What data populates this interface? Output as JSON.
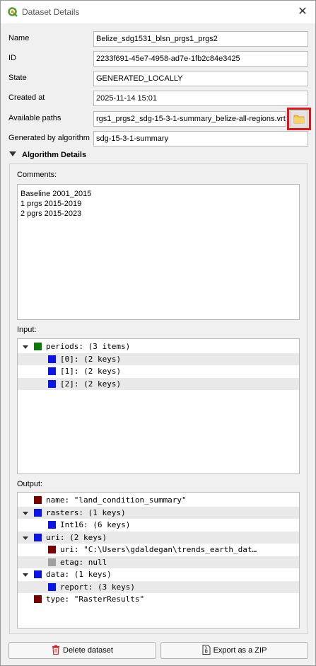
{
  "window": {
    "title": "Dataset Details",
    "close_glyph": "✕"
  },
  "fields": {
    "name": {
      "label": "Name",
      "value": "Belize_sdg1531_blsn_prgs1_prgs2"
    },
    "id": {
      "label": "ID",
      "value": "2233f691-45e7-4958-ad7e-1fb2c84e3425"
    },
    "state": {
      "label": "State",
      "value": "GENERATED_LOCALLY"
    },
    "created": {
      "label": "Created at",
      "value": "2025-11-14 15:01"
    },
    "paths": {
      "label": "Available paths",
      "value": "rgs1_prgs2_sdg-15-3-1-summary_belize-all-regions.vrt"
    },
    "algorithm": {
      "label": "Generated by algorithm",
      "value": "sdg-15-3-1-summary"
    }
  },
  "algorithm_details": {
    "heading": "Algorithm Details",
    "comments_label": "Comments:",
    "comments": [
      "Baseline 2001_2015",
      "1 prgs 2015-2019",
      "2 pgrs 2015-2023"
    ],
    "input_label": "Input:",
    "input_tree": [
      {
        "text": "periods: (3 items)",
        "color": "green",
        "expander": "down",
        "level": 0
      },
      {
        "text": "[0]: (2 keys)",
        "color": "blue",
        "expander": "right",
        "level": 1
      },
      {
        "text": "[1]: (2 keys)",
        "color": "blue",
        "expander": "right",
        "level": 1
      },
      {
        "text": "[2]: (2 keys)",
        "color": "blue",
        "expander": "right",
        "level": 1
      }
    ],
    "output_label": "Output:",
    "output_tree": [
      {
        "text": "name: \"land_condition_summary\"",
        "color": "red",
        "expander": "none",
        "level": 0
      },
      {
        "text": "rasters: (1 keys)",
        "color": "blue",
        "expander": "down",
        "level": 0
      },
      {
        "text": "Int16: (6 keys)",
        "color": "blue",
        "expander": "right",
        "level": 1
      },
      {
        "text": "uri: (2 keys)",
        "color": "blue",
        "expander": "down",
        "level": 0
      },
      {
        "text": "uri: \"C:\\Users\\gdaldegan\\trends_earth_dat…",
        "color": "red",
        "expander": "none",
        "level": 1
      },
      {
        "text": "etag: null",
        "color": "gray",
        "expander": "none",
        "level": 1
      },
      {
        "text": "data: (1 keys)",
        "color": "blue",
        "expander": "down",
        "level": 0
      },
      {
        "text": "report: (3 keys)",
        "color": "blue",
        "expander": "right",
        "level": 1
      },
      {
        "text": "type: \"RasterResults\"",
        "color": "red",
        "expander": "none",
        "level": 0
      }
    ]
  },
  "buttons": {
    "delete": "Delete dataset",
    "export": "Export as a ZIP"
  },
  "colors": {
    "highlight": "#e8111a",
    "green": "#0b7a0b",
    "blue": "#0a14e6",
    "red": "#7a0000",
    "gray": "#a0a0a0"
  }
}
